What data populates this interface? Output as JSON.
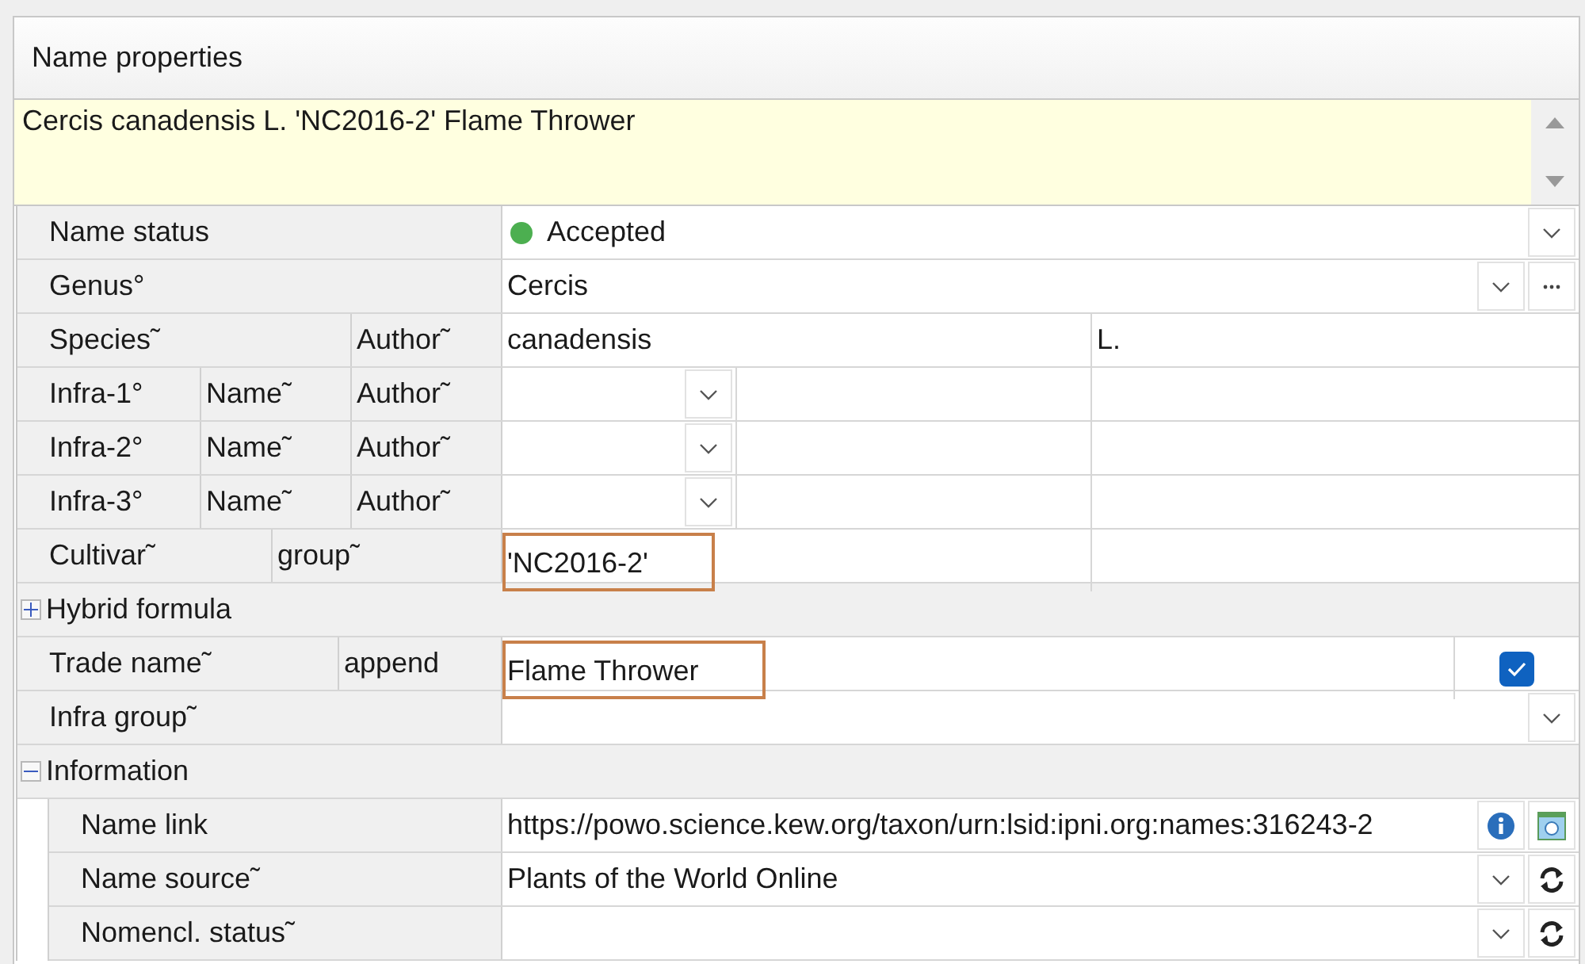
{
  "panel": {
    "title": "Name properties"
  },
  "summary": {
    "text": "Cercis canadensis L. 'NC2016-2' Flame Thrower"
  },
  "rows": [
    {
      "kind": "single",
      "labels": [
        "Name status"
      ],
      "cells": [
        {
          "kind": "text",
          "value": "Accepted",
          "color": "#4caf50",
          "buttons": [
            {
              "kind": "dropdown"
            }
          ]
        }
      ]
    },
    {
      "kind": "single",
      "labels": [
        "Genus°"
      ],
      "cells": [
        {
          "kind": "text",
          "value": "Cercis",
          "buttons": [
            {
              "kind": "dropdown"
            },
            {
              "kind": "more"
            }
          ]
        }
      ]
    },
    {
      "kind": "species",
      "labels": [
        "Species˜",
        "Author˜"
      ],
      "cells": [
        {
          "kind": "text",
          "value": "canadensis"
        },
        {
          "kind": "text",
          "value": "L."
        }
      ]
    },
    {
      "kind": "infra",
      "labels": [
        "Infra-1°",
        "Name˜",
        "Author˜"
      ],
      "cells": [
        {
          "kind": "text",
          "buttons": [
            {
              "kind": "dropdown"
            }
          ]
        },
        {
          "kind": "text"
        },
        {
          "kind": "text"
        }
      ]
    },
    {
      "kind": "infra",
      "labels": [
        "Infra-2°",
        "Name˜",
        "Author˜"
      ],
      "cells": [
        {
          "kind": "text",
          "buttons": [
            {
              "kind": "dropdown"
            }
          ]
        },
        {
          "kind": "text"
        },
        {
          "kind": "text"
        }
      ]
    },
    {
      "kind": "infra",
      "labels": [
        "Infra-3°",
        "Name˜",
        "Author˜"
      ],
      "cells": [
        {
          "kind": "text",
          "buttons": [
            {
              "kind": "dropdown"
            }
          ]
        },
        {
          "kind": "text"
        },
        {
          "kind": "text"
        }
      ]
    },
    {
      "kind": "cultivar",
      "labels": [
        "Cultivar˜",
        "group˜"
      ],
      "cells": [
        {
          "kind": "text",
          "value": "'NC2016-2'",
          "highlighted": true
        },
        {
          "kind": "text"
        }
      ]
    },
    {
      "kind": "group",
      "label": "Hybrid formula",
      "expanded": false
    },
    {
      "kind": "trade",
      "labels": [
        "Trade name˜",
        "append"
      ],
      "cells": [
        {
          "kind": "text",
          "value": "Flame Thrower",
          "highlighted": true
        },
        {
          "kind": "checkbox",
          "checked": true
        }
      ]
    },
    {
      "kind": "single",
      "labels": [
        "Infra group˜"
      ],
      "cells": [
        {
          "kind": "text",
          "buttons": [
            {
              "kind": "dropdown"
            }
          ]
        }
      ]
    },
    {
      "kind": "group",
      "label": "Information",
      "expanded": true,
      "children": [
        {
          "kind": "single",
          "labels": [
            "Name link"
          ],
          "cells": [
            {
              "kind": "text",
              "value": "https://powo.science.kew.org/taxon/urn:lsid:ipni.org:names:316243-2",
              "buttons": [
                {
                  "kind": "info"
                },
                {
                  "kind": "web"
                }
              ]
            }
          ]
        },
        {
          "kind": "single",
          "labels": [
            "Name source˜"
          ],
          "cells": [
            {
              "kind": "text",
              "value": "Plants of the World Online",
              "buttons": [
                {
                  "kind": "dropdown"
                },
                {
                  "kind": "refresh"
                }
              ]
            }
          ]
        },
        {
          "kind": "single",
          "labels": [
            "Nomencl. status˜"
          ],
          "cells": [
            {
              "kind": "text",
              "buttons": [
                {
                  "kind": "dropdown"
                },
                {
                  "kind": "refresh"
                }
              ]
            }
          ]
        }
      ]
    }
  ]
}
